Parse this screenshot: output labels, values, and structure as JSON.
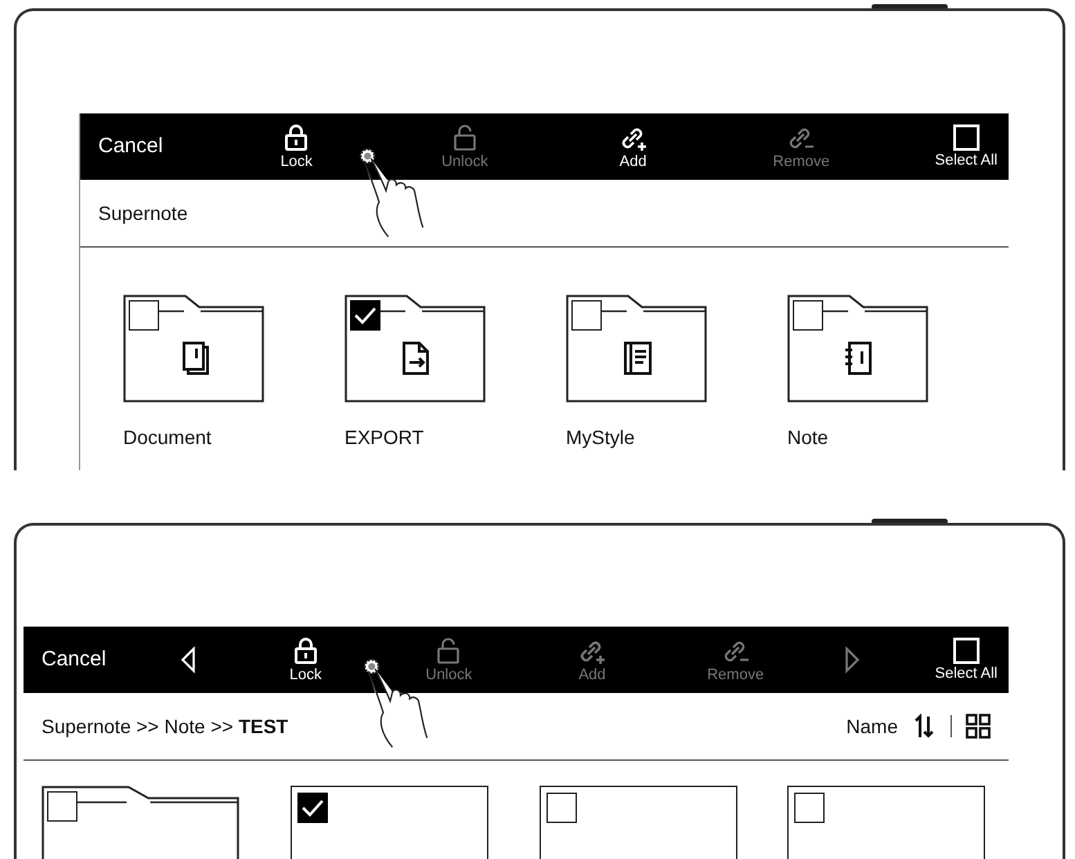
{
  "panels": [
    {
      "toolbar": [
        {
          "kind": "cancel",
          "label": "Cancel",
          "disabled": false
        },
        {
          "kind": "lock",
          "label": "Lock",
          "disabled": false
        },
        {
          "kind": "unlock",
          "label": "Unlock",
          "disabled": true
        },
        {
          "kind": "add_link",
          "label": "Add",
          "disabled": false
        },
        {
          "kind": "remove_link",
          "label": "Remove",
          "disabled": true
        },
        {
          "kind": "select_all",
          "label": "Select All",
          "disabled": false
        }
      ],
      "path": "Supernote",
      "items": [
        {
          "kind": "document",
          "name": "Document",
          "checked": false
        },
        {
          "kind": "export",
          "name": "EXPORT",
          "checked": true
        },
        {
          "kind": "styles",
          "name": "MyStyle",
          "checked": false
        },
        {
          "kind": "notebook",
          "name": "Note",
          "checked": false
        }
      ]
    },
    {
      "toolbar": [
        {
          "kind": "cancel",
          "label": "Cancel",
          "disabled": false
        },
        {
          "kind": "prev",
          "disabled": false
        },
        {
          "kind": "lock",
          "label": "Lock",
          "disabled": false
        },
        {
          "kind": "unlock",
          "label": "Unlock",
          "disabled": true
        },
        {
          "kind": "add_link",
          "label": "Add",
          "disabled": true
        },
        {
          "kind": "remove_link",
          "label": "Remove",
          "disabled": true
        },
        {
          "kind": "next",
          "disabled": true
        },
        {
          "kind": "select_all",
          "label": "Select All",
          "disabled": false
        }
      ],
      "path": "Supernote >> Note >> **TEST**",
      "sort": {
        "label": "Name"
      },
      "items": [
        {
          "kind": "folder",
          "checked": false
        },
        {
          "kind": "file",
          "checked": true
        },
        {
          "kind": "file",
          "checked": false
        },
        {
          "kind": "file",
          "checked": false
        }
      ]
    }
  ]
}
